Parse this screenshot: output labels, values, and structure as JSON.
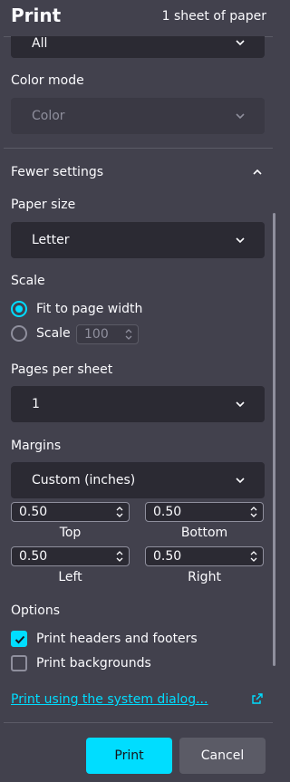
{
  "header": {
    "title": "Print",
    "sheet_count": "1 sheet of paper"
  },
  "pages_select": {
    "value": "All"
  },
  "color_mode": {
    "label": "Color mode",
    "value": "Color"
  },
  "more_settings": {
    "label": "Fewer settings"
  },
  "paper_size": {
    "label": "Paper size",
    "value": "Letter"
  },
  "scale": {
    "label": "Scale",
    "fit_label": "Fit to page width",
    "scale_label": "Scale",
    "scale_value": "100"
  },
  "pages_per_sheet": {
    "label": "Pages per sheet",
    "value": "1"
  },
  "margins": {
    "label": "Margins",
    "value": "Custom (inches)",
    "top": "0.50",
    "top_label": "Top",
    "bottom": "0.50",
    "bottom_label": "Bottom",
    "left": "0.50",
    "left_label": "Left",
    "right": "0.50",
    "right_label": "Right"
  },
  "options": {
    "label": "Options",
    "headers_footers": "Print headers and footers",
    "backgrounds": "Print backgrounds"
  },
  "system_dialog_link": "Print using the system dialog...",
  "footer": {
    "print": "Print",
    "cancel": "Cancel"
  },
  "colors": {
    "accent": "#00ddff",
    "background": "#42414d",
    "field": "#2b2a33"
  }
}
